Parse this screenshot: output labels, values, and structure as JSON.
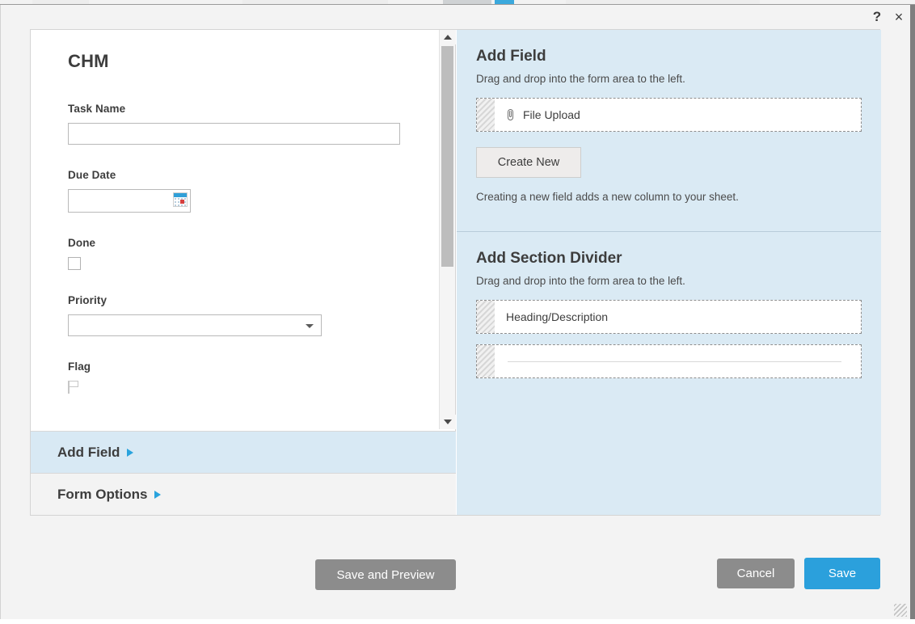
{
  "window": {
    "help_icon": "?",
    "close_icon": "×",
    "resize_grip": "resize-grip"
  },
  "form_panel": {
    "title": "CHM",
    "fields": [
      {
        "label": "Task Name",
        "type": "text",
        "value": ""
      },
      {
        "label": "Due Date",
        "type": "date",
        "value": "",
        "icon": "calendar-icon"
      },
      {
        "label": "Done",
        "type": "checkbox",
        "checked": false
      },
      {
        "label": "Priority",
        "type": "select",
        "value": "",
        "icon": "chevron-down-icon"
      },
      {
        "label": "Flag",
        "type": "flag",
        "icon": "flag-icon"
      }
    ],
    "scrollbar": {
      "up_arrow": "scroll-up-arrow",
      "down_arrow": "scroll-down-arrow"
    },
    "accordion": [
      {
        "label": "Add Field",
        "state": "active"
      },
      {
        "label": "Form Options",
        "state": "inactive"
      }
    ]
  },
  "side_panel": {
    "add_field": {
      "title": "Add Field",
      "subtitle": "Drag and drop into the form area to the left.",
      "drag_items": [
        {
          "label": "File Upload",
          "icon": "paperclip-icon"
        }
      ],
      "create_new_label": "Create New",
      "note": "Creating a new field adds a new column to your sheet."
    },
    "add_section_divider": {
      "title": "Add Section Divider",
      "subtitle": "Drag and drop into the form area to the left.",
      "drag_items": [
        {
          "label": "Heading/Description",
          "icon": ""
        },
        {
          "label": "",
          "icon": "horizontal-rule-icon"
        }
      ]
    }
  },
  "footer": {
    "save_and_preview_label": "Save and Preview",
    "cancel_label": "Cancel",
    "save_label": "Save"
  },
  "colors": {
    "accent_blue": "#2ba0dc",
    "panel_blue": "#daeaf4",
    "accordion_active": "#d8e9f4",
    "button_gray": "#8c8c8c",
    "text_dark": "#3d3d3d"
  }
}
